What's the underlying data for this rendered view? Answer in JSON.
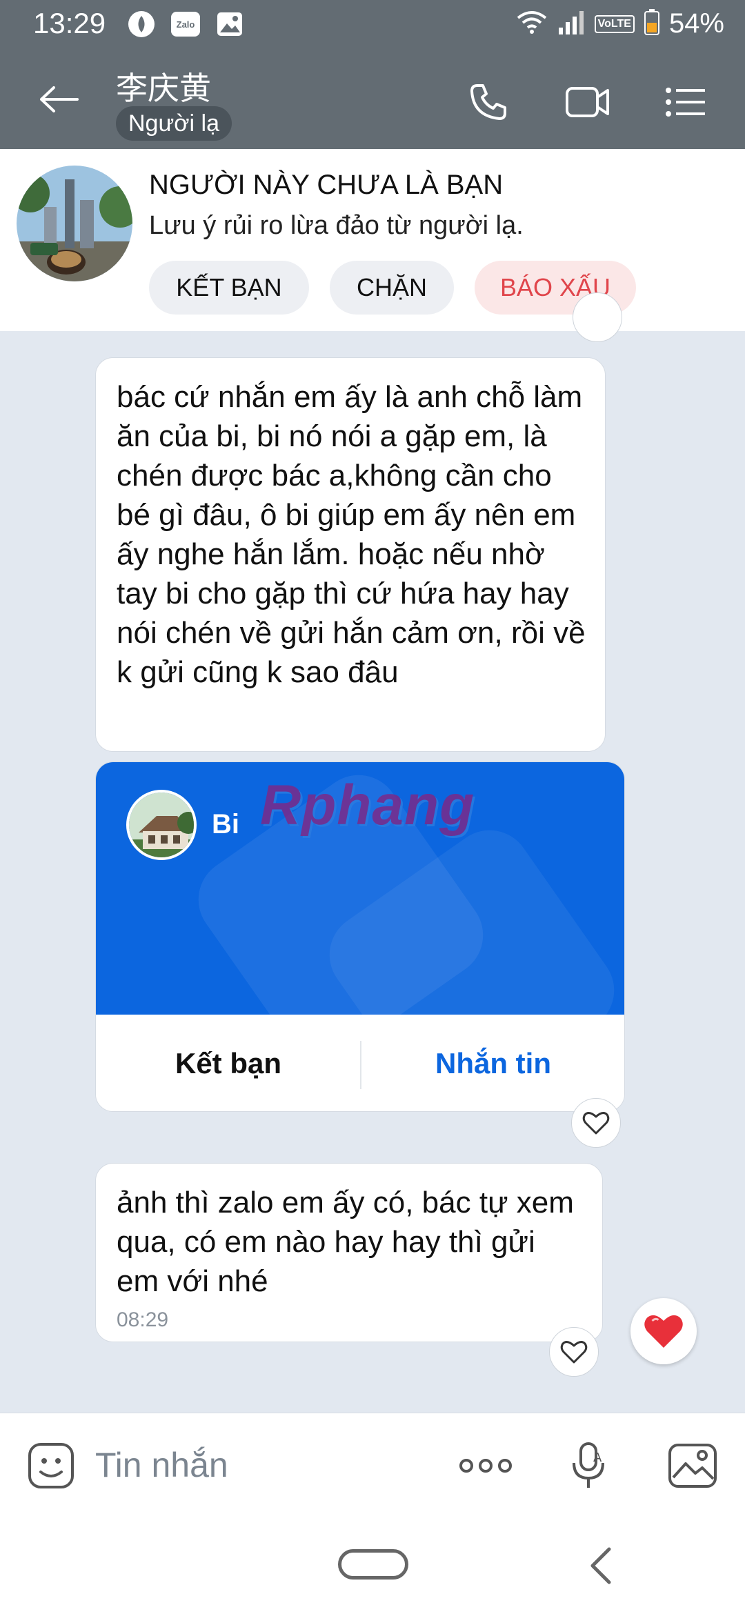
{
  "status_bar": {
    "time": "13:29",
    "zalo_badge": "Zalo",
    "network": "VoLTE",
    "battery": "54%"
  },
  "header": {
    "contact_name": "李庆黄",
    "stranger_tag": "Người lạ"
  },
  "banner": {
    "title": "NGƯỜI NÀY CHƯA LÀ BẠN",
    "subtitle": "Lưu ý rủi ro lừa đảo từ người lạ.",
    "add_friend": "KẾT BẠN",
    "block": "CHẶN",
    "report": "BÁO XẤU"
  },
  "messages": [
    {
      "text": "bác cứ nhắn em ấy là anh chỗ làm ăn của bi, bi nó nói a gặp em, là chén được bác a,không cần cho bé gì đâu,  ô bi giúp em ấy nên em ấy nghe hắn lắm. hoặc nếu nhờ tay bi cho gặp thì cứ hứa hay hay nói chén về gửi hắn cảm ơn, rồi về k gửi cũng k sao đâu"
    },
    {
      "text": "ảnh thì zalo em ấy có, bác tự xem qua, có em nào hay hay thì gửi em với nhé",
      "time": "08:29"
    }
  ],
  "contact_card": {
    "name": "Bi",
    "watermark": "Rphang",
    "add_friend": "Kết bạn",
    "message": "Nhắn tin"
  },
  "input": {
    "placeholder": "Tin nhắn"
  },
  "colors": {
    "header_bg": "#636c73",
    "accent_blue": "#0c66df",
    "report_red": "#e0454b",
    "chat_bg": "#e2e8f0"
  }
}
